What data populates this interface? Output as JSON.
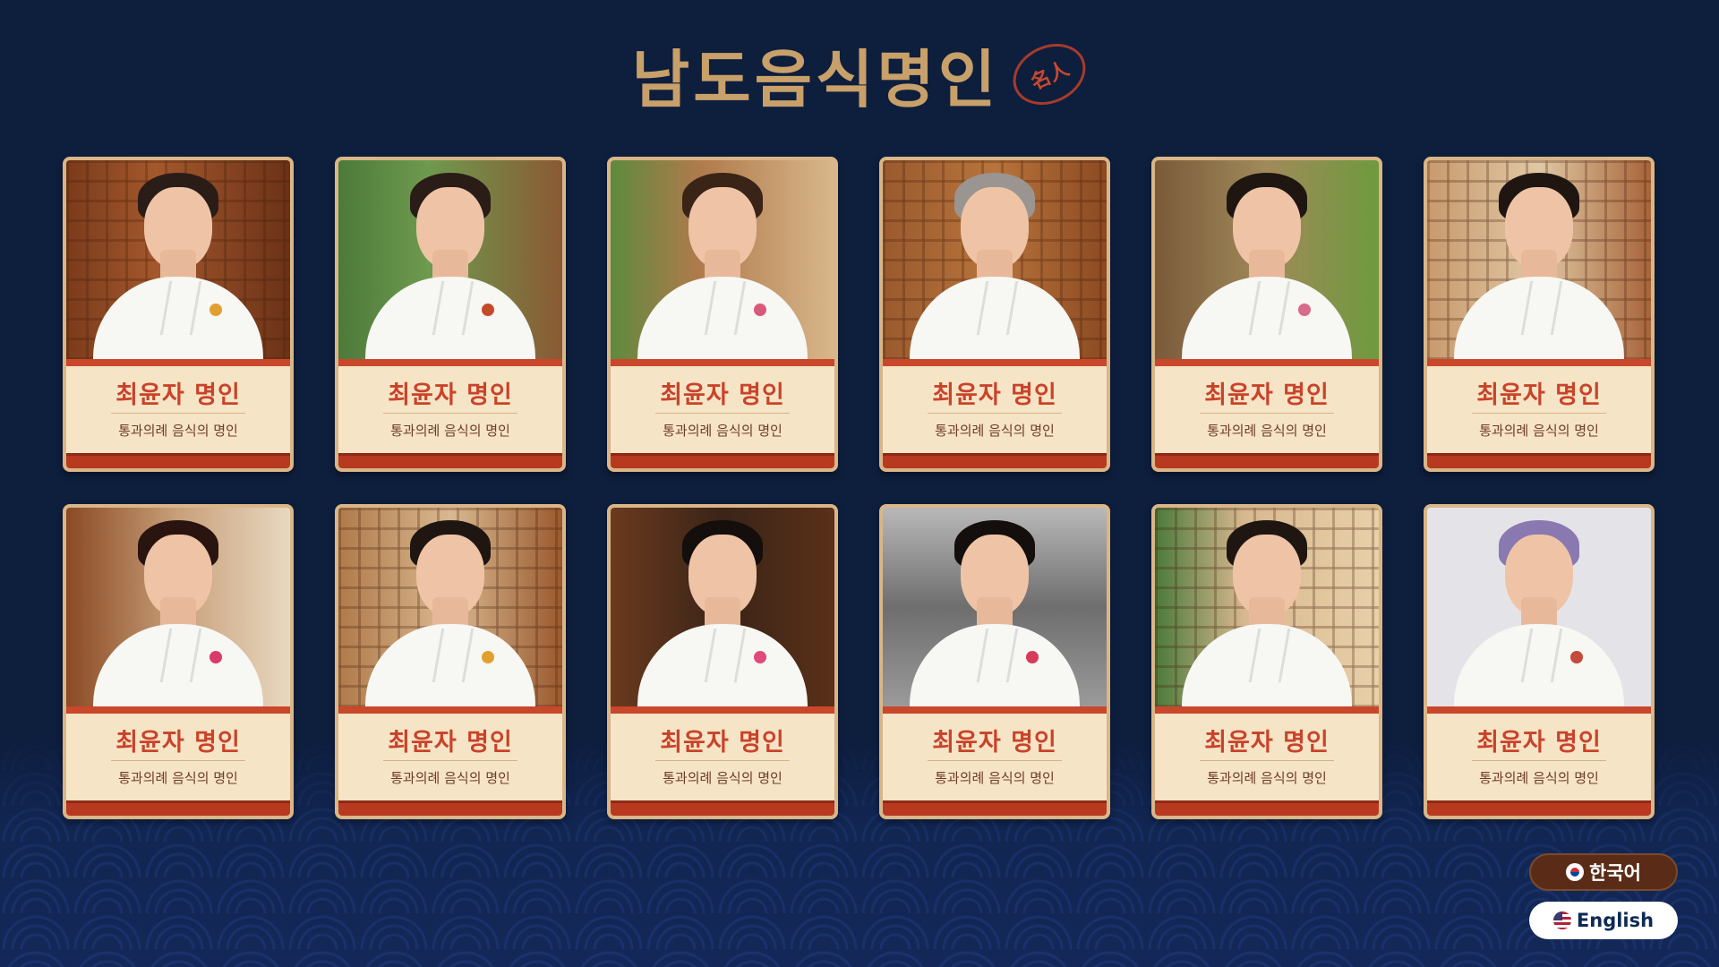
{
  "header": {
    "title": "남도음식명인",
    "seal_text": "名人"
  },
  "cards": [
    {
      "name": "최윤자 명인",
      "subtitle": "통과의례 음식의 명인"
    },
    {
      "name": "최윤자 명인",
      "subtitle": "통과의례 음식의 명인"
    },
    {
      "name": "최윤자 명인",
      "subtitle": "통과의례 음식의 명인"
    },
    {
      "name": "최윤자 명인",
      "subtitle": "통과의례 음식의 명인"
    },
    {
      "name": "최윤자 명인",
      "subtitle": "통과의례 음식의 명인"
    },
    {
      "name": "최윤자 명인",
      "subtitle": "통과의례 음식의 명인"
    },
    {
      "name": "최윤자 명인",
      "subtitle": "통과의례 음식의 명인"
    },
    {
      "name": "최윤자 명인",
      "subtitle": "통과의례 음식의 명인"
    },
    {
      "name": "최윤자 명인",
      "subtitle": "통과의례 음식의 명인"
    },
    {
      "name": "최윤자 명인",
      "subtitle": "통과의례 음식의 명인"
    },
    {
      "name": "최윤자 명인",
      "subtitle": "통과의례 음식의 명인"
    },
    {
      "name": "최윤자 명인",
      "subtitle": "통과의례 음식의 명인"
    }
  ],
  "language": {
    "korean_label": "한국어",
    "english_label": "English"
  },
  "colors": {
    "background": "#0e1e3d",
    "title_gold": "#c8a06a",
    "name_red": "#c9432a",
    "card_cream": "#f6e4c6",
    "accent_red": "#c9472b"
  }
}
